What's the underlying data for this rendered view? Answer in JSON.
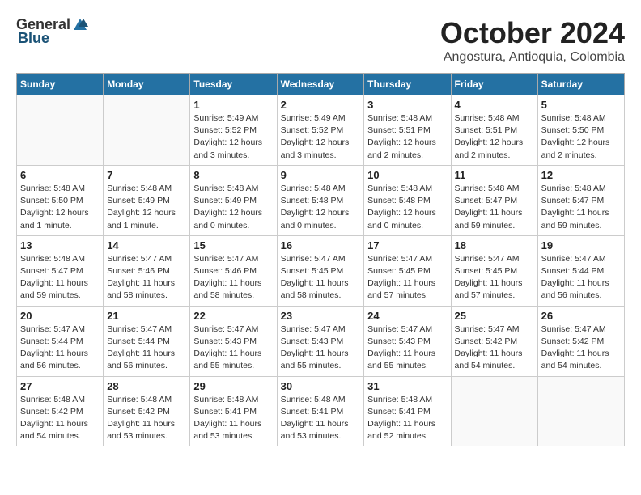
{
  "header": {
    "logo_general": "General",
    "logo_blue": "Blue",
    "month_title": "October 2024",
    "subtitle": "Angostura, Antioquia, Colombia"
  },
  "calendar": {
    "days_of_week": [
      "Sunday",
      "Monday",
      "Tuesday",
      "Wednesday",
      "Thursday",
      "Friday",
      "Saturday"
    ],
    "weeks": [
      [
        {
          "day": "",
          "info": ""
        },
        {
          "day": "",
          "info": ""
        },
        {
          "day": "1",
          "info": "Sunrise: 5:49 AM\nSunset: 5:52 PM\nDaylight: 12 hours\nand 3 minutes."
        },
        {
          "day": "2",
          "info": "Sunrise: 5:49 AM\nSunset: 5:52 PM\nDaylight: 12 hours\nand 3 minutes."
        },
        {
          "day": "3",
          "info": "Sunrise: 5:48 AM\nSunset: 5:51 PM\nDaylight: 12 hours\nand 2 minutes."
        },
        {
          "day": "4",
          "info": "Sunrise: 5:48 AM\nSunset: 5:51 PM\nDaylight: 12 hours\nand 2 minutes."
        },
        {
          "day": "5",
          "info": "Sunrise: 5:48 AM\nSunset: 5:50 PM\nDaylight: 12 hours\nand 2 minutes."
        }
      ],
      [
        {
          "day": "6",
          "info": "Sunrise: 5:48 AM\nSunset: 5:50 PM\nDaylight: 12 hours\nand 1 minute."
        },
        {
          "day": "7",
          "info": "Sunrise: 5:48 AM\nSunset: 5:49 PM\nDaylight: 12 hours\nand 1 minute."
        },
        {
          "day": "8",
          "info": "Sunrise: 5:48 AM\nSunset: 5:49 PM\nDaylight: 12 hours\nand 0 minutes."
        },
        {
          "day": "9",
          "info": "Sunrise: 5:48 AM\nSunset: 5:48 PM\nDaylight: 12 hours\nand 0 minutes."
        },
        {
          "day": "10",
          "info": "Sunrise: 5:48 AM\nSunset: 5:48 PM\nDaylight: 12 hours\nand 0 minutes."
        },
        {
          "day": "11",
          "info": "Sunrise: 5:48 AM\nSunset: 5:47 PM\nDaylight: 11 hours\nand 59 minutes."
        },
        {
          "day": "12",
          "info": "Sunrise: 5:48 AM\nSunset: 5:47 PM\nDaylight: 11 hours\nand 59 minutes."
        }
      ],
      [
        {
          "day": "13",
          "info": "Sunrise: 5:48 AM\nSunset: 5:47 PM\nDaylight: 11 hours\nand 59 minutes."
        },
        {
          "day": "14",
          "info": "Sunrise: 5:47 AM\nSunset: 5:46 PM\nDaylight: 11 hours\nand 58 minutes."
        },
        {
          "day": "15",
          "info": "Sunrise: 5:47 AM\nSunset: 5:46 PM\nDaylight: 11 hours\nand 58 minutes."
        },
        {
          "day": "16",
          "info": "Sunrise: 5:47 AM\nSunset: 5:45 PM\nDaylight: 11 hours\nand 58 minutes."
        },
        {
          "day": "17",
          "info": "Sunrise: 5:47 AM\nSunset: 5:45 PM\nDaylight: 11 hours\nand 57 minutes."
        },
        {
          "day": "18",
          "info": "Sunrise: 5:47 AM\nSunset: 5:45 PM\nDaylight: 11 hours\nand 57 minutes."
        },
        {
          "day": "19",
          "info": "Sunrise: 5:47 AM\nSunset: 5:44 PM\nDaylight: 11 hours\nand 56 minutes."
        }
      ],
      [
        {
          "day": "20",
          "info": "Sunrise: 5:47 AM\nSunset: 5:44 PM\nDaylight: 11 hours\nand 56 minutes."
        },
        {
          "day": "21",
          "info": "Sunrise: 5:47 AM\nSunset: 5:44 PM\nDaylight: 11 hours\nand 56 minutes."
        },
        {
          "day": "22",
          "info": "Sunrise: 5:47 AM\nSunset: 5:43 PM\nDaylight: 11 hours\nand 55 minutes."
        },
        {
          "day": "23",
          "info": "Sunrise: 5:47 AM\nSunset: 5:43 PM\nDaylight: 11 hours\nand 55 minutes."
        },
        {
          "day": "24",
          "info": "Sunrise: 5:47 AM\nSunset: 5:43 PM\nDaylight: 11 hours\nand 55 minutes."
        },
        {
          "day": "25",
          "info": "Sunrise: 5:47 AM\nSunset: 5:42 PM\nDaylight: 11 hours\nand 54 minutes."
        },
        {
          "day": "26",
          "info": "Sunrise: 5:47 AM\nSunset: 5:42 PM\nDaylight: 11 hours\nand 54 minutes."
        }
      ],
      [
        {
          "day": "27",
          "info": "Sunrise: 5:48 AM\nSunset: 5:42 PM\nDaylight: 11 hours\nand 54 minutes."
        },
        {
          "day": "28",
          "info": "Sunrise: 5:48 AM\nSunset: 5:42 PM\nDaylight: 11 hours\nand 53 minutes."
        },
        {
          "day": "29",
          "info": "Sunrise: 5:48 AM\nSunset: 5:41 PM\nDaylight: 11 hours\nand 53 minutes."
        },
        {
          "day": "30",
          "info": "Sunrise: 5:48 AM\nSunset: 5:41 PM\nDaylight: 11 hours\nand 53 minutes."
        },
        {
          "day": "31",
          "info": "Sunrise: 5:48 AM\nSunset: 5:41 PM\nDaylight: 11 hours\nand 52 minutes."
        },
        {
          "day": "",
          "info": ""
        },
        {
          "day": "",
          "info": ""
        }
      ]
    ]
  }
}
